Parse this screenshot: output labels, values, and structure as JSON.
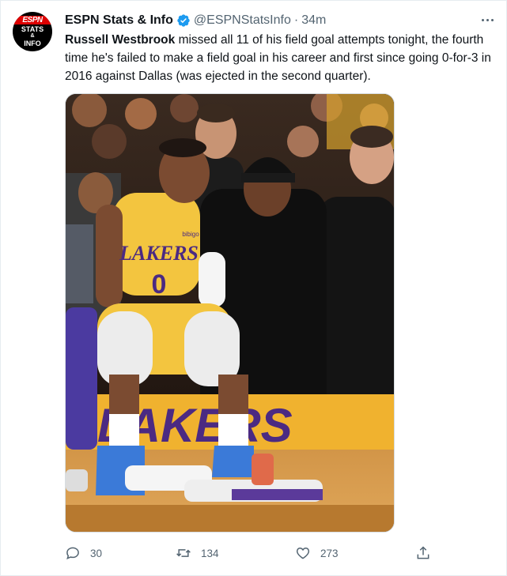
{
  "tweet": {
    "author_name": "ESPN Stats & Info",
    "handle": "@ESPNStatsInfo",
    "separator": "·",
    "time": "34m",
    "avatar": {
      "line1": "ESPN",
      "line2": "STATS",
      "line3": "&",
      "line4": "INFO"
    },
    "text_bold": "Russell Westbrook",
    "text_rest": " missed all 11 of his field goal attempts tonight, the fourth time he's failed to make a field goal in his career and first since going 0-for-3 in 2016 against Dallas (was ejected in the second quarter).",
    "photo": {
      "jersey_team": "LAKERS",
      "jersey_number": "0",
      "jersey_patch": "bibigo",
      "floor_text": "LAKERS"
    },
    "actions": {
      "replies": "30",
      "retweets": "134",
      "likes": "273"
    }
  },
  "colors": {
    "verified_blue": "#1d9bf0",
    "muted_text": "#536471",
    "primary_text": "#0f1419",
    "lakers_gold": "#f5c542",
    "lakers_purple": "#4b2a82"
  },
  "icons": [
    "verified-badge-icon",
    "more-options-icon",
    "reply-icon",
    "retweet-icon",
    "like-icon",
    "share-icon"
  ]
}
